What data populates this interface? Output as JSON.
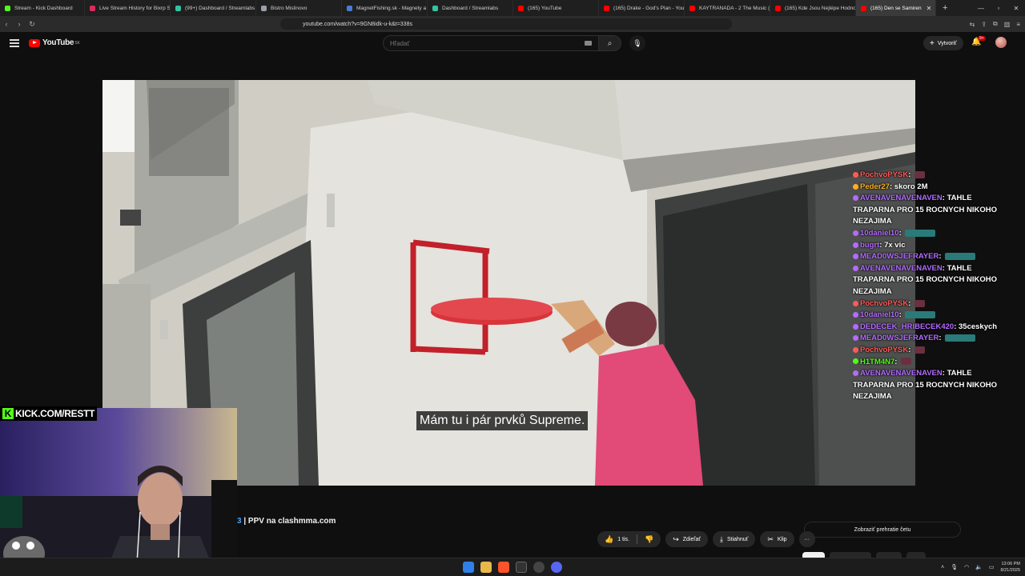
{
  "browser": {
    "tabs": [
      {
        "label": "Stream - Kick Dashboard",
        "color": "#53fc18"
      },
      {
        "label": "Live Stream History for Bixrp St",
        "color": "#e02a5b"
      },
      {
        "label": "(99+) Dashboard / Streamlabs",
        "color": "#31c3a2"
      },
      {
        "label": "Bistro Mislinovo",
        "color": "#9aa0a6"
      },
      {
        "label": "MagnetFishing.sk - Magnety a",
        "color": "#4a7bd8"
      },
      {
        "label": "Dashboard / Streamlabs",
        "color": "#31c3a2"
      },
      {
        "label": "(165) YouTube",
        "color": "#ff0000"
      },
      {
        "label": "(165) Drake - God's Plan - You",
        "color": "#ff0000"
      },
      {
        "label": "KAYTRANADA - 2 The Music (I",
        "color": "#ff0000"
      },
      {
        "label": "(165) Kde Jsou Nejlépe Hodno",
        "color": "#ff0000"
      },
      {
        "label": "(165) Den se Samiren",
        "color": "#ff0000",
        "active": true
      }
    ],
    "new_tab": "+",
    "url": "youtube.com/watch?v=9GN8idk-u-k&t=338s"
  },
  "youtube": {
    "logo": "YouTube",
    "region": "SK",
    "search_placeholder": "Hľadať",
    "create_label": "Vytvoriť",
    "notifications": "9+"
  },
  "video": {
    "subtitle": "Mám tu i pár prvků Supreme."
  },
  "chat": [
    {
      "user": "PochvoPYSK",
      "color": "#ff5a5a",
      "msg": "",
      "emote": "small"
    },
    {
      "user": "Peder27",
      "color": "#ffb020",
      "msg": "skoro 2M",
      "emote": ""
    },
    {
      "user": "AVENAVENAVENAVEN",
      "color": "#b46bff",
      "msg": "TAHLE TRAPARNA PRO 15 ROCNYCH NIKOHO NEZAJIMA",
      "emote": ""
    },
    {
      "user": "10daniel10",
      "color": "#b46bff",
      "msg": "",
      "emote": "wide"
    },
    {
      "user": "bugrt",
      "color": "#b46bff",
      "msg": "7x vic",
      "emote": ""
    },
    {
      "user": "MEAD0WSJEFRAYER",
      "color": "#b46bff",
      "msg": "",
      "emote": "wide"
    },
    {
      "user": "AVENAVENAVENAVEN",
      "color": "#b46bff",
      "msg": "TAHLE TRAPARNA PRO 15 ROCNYCH NIKOHO NEZAJIMA",
      "emote": ""
    },
    {
      "user": "PochvoPYSK",
      "color": "#ff5a5a",
      "msg": "",
      "emote": "small"
    },
    {
      "user": "10daniel10",
      "color": "#b46bff",
      "msg": "",
      "emote": "wide"
    },
    {
      "user": "DEDECEK_HRIBECEK420",
      "color": "#b46bff",
      "msg": "35ceskych",
      "emote": ""
    },
    {
      "user": "MEAD0WSJEFRAYER",
      "color": "#b46bff",
      "msg": "",
      "emote": "wide"
    },
    {
      "user": "PochvoPYSK",
      "color": "#ff5a5a",
      "msg": "",
      "emote": "small"
    },
    {
      "user": "H1TM4N7",
      "color": "#53fc18",
      "msg": "",
      "emote": "small"
    },
    {
      "user": "AVENAVENAVENAVEN",
      "color": "#b46bff",
      "msg": "TAHLE TRAPARNA PRO 15 ROCNYCH NIKOHO NEZAJIMA",
      "emote": ""
    }
  ],
  "overlay": {
    "kick_label": "KICK.COM/RESTT"
  },
  "below": {
    "title_prefix": "3",
    "title": " | PPV na clashmma.com",
    "like_count": "1 tis.",
    "share": "Zdieľať",
    "download": "Stiahnuť",
    "clip": "Klip",
    "more": "···",
    "chat_replay": "Zobraziť prehratie četu"
  },
  "taskbar": {
    "time": "13:06 PM",
    "date": "8/21/2025"
  }
}
